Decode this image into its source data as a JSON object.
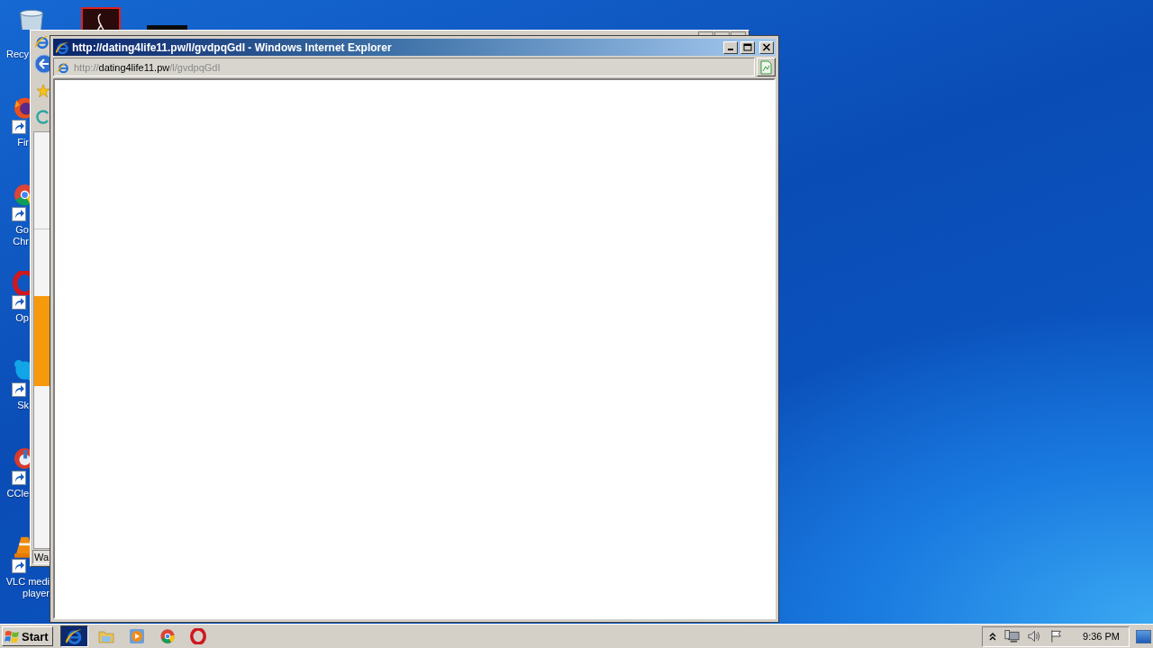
{
  "desktop": {
    "icons": [
      {
        "kind": "recycle-bin",
        "shortcut": false,
        "label_lines": [
          "Recy"
        ]
      },
      {
        "kind": "firefox",
        "shortcut": true,
        "label_lines": [
          "Fir"
        ]
      },
      {
        "kind": "chrome",
        "shortcut": true,
        "label_lines": [
          "Go",
          "Chr"
        ]
      },
      {
        "kind": "opera",
        "shortcut": true,
        "label_lines": [
          "Op"
        ]
      },
      {
        "kind": "skype",
        "shortcut": true,
        "label_lines": [
          "Sk"
        ]
      },
      {
        "kind": "ccleaner",
        "shortcut": true,
        "label_lines": [
          "CCle"
        ]
      },
      {
        "kind": "vlc",
        "shortcut": true,
        "label_lines": [
          "VLC medi",
          "player"
        ]
      }
    ],
    "top_icons": [
      {
        "kind": "acrobat"
      },
      {
        "kind": "dark-app"
      }
    ]
  },
  "background_window": {
    "status_text": "Wa"
  },
  "browser_window": {
    "title": "http://dating4life11.pw/l/gvdpqGdI - Windows Internet Explorer",
    "address": {
      "scheme": "http://",
      "host": "dating4life11.pw",
      "path": "/l/gvdpqGdI"
    }
  },
  "taskbar": {
    "start_label": "Start",
    "tasks": [
      {
        "kind": "ie",
        "selected": true
      }
    ],
    "quick_launch": [
      {
        "kind": "folder"
      },
      {
        "kind": "media-player"
      },
      {
        "kind": "chrome"
      },
      {
        "kind": "opera"
      }
    ],
    "tray": [
      {
        "kind": "expand"
      },
      {
        "kind": "network"
      },
      {
        "kind": "volume"
      },
      {
        "kind": "flag"
      }
    ],
    "clock": "9:36 PM"
  }
}
